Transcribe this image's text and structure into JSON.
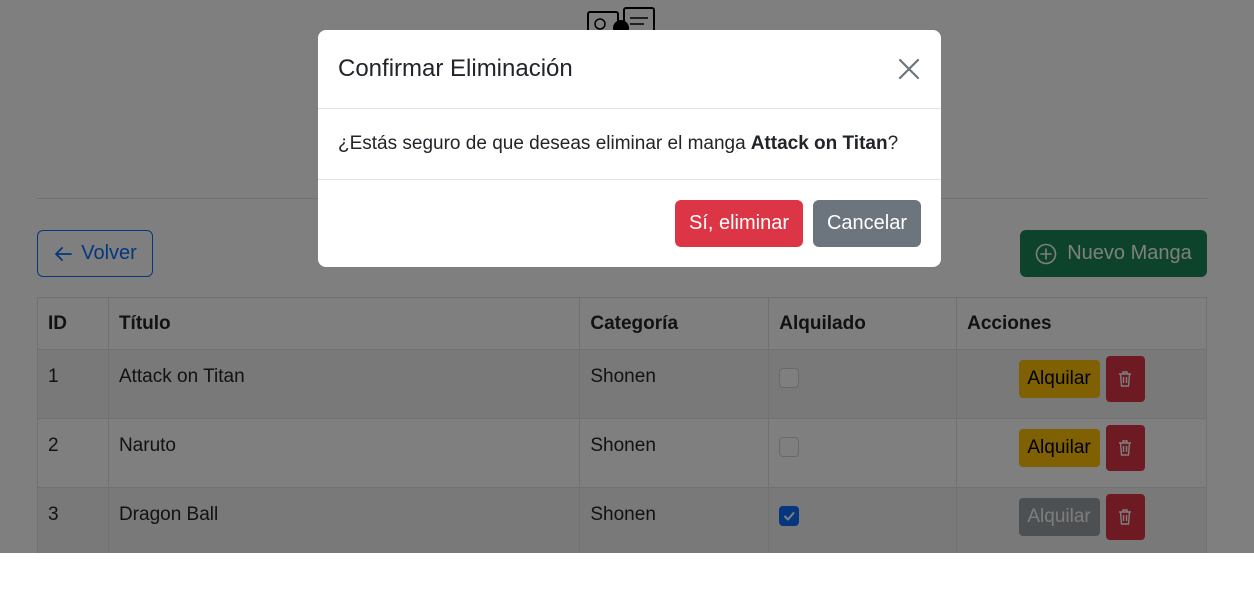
{
  "page": {
    "back_label": "Volver",
    "new_label": "Nuevo Manga"
  },
  "table": {
    "headers": [
      "ID",
      "Título",
      "Categoría",
      "Alquilado",
      "Acciones"
    ],
    "rows": [
      {
        "id": "1",
        "title": "Attack on Titan",
        "category": "Shonen",
        "rented": false,
        "action": "Alquilar"
      },
      {
        "id": "2",
        "title": "Naruto",
        "category": "Shonen",
        "rented": false,
        "action": "Alquilar"
      },
      {
        "id": "3",
        "title": "Dragon Ball",
        "category": "Shonen",
        "rented": true,
        "action": "Alquilar"
      }
    ]
  },
  "modal": {
    "title": "Confirmar Eliminación",
    "message_prefix": "¿Estás seguro de que deseas eliminar el manga",
    "manga_name": "Attack on Titan",
    "message_suffix": "?",
    "confirm_label": "Sí, eliminar",
    "cancel_label": "Cancelar"
  },
  "icons": {
    "back": "arrow-left-icon",
    "new": "plus-circle-icon",
    "delete": "trash-icon",
    "close": "close-icon",
    "check": "check-icon"
  },
  "colors": {
    "primary": "#0d6efd",
    "success": "#198754",
    "danger": "#dc3545",
    "warning": "#ffc107",
    "secondary": "#6c757d"
  }
}
